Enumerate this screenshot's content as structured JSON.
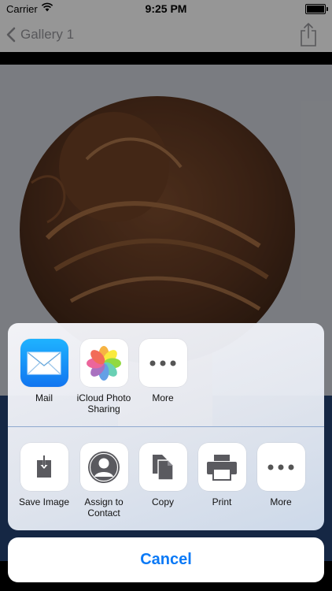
{
  "status_bar": {
    "carrier": "Carrier",
    "time": "9:25 PM"
  },
  "nav": {
    "back_label": "Gallery 1"
  },
  "share_sheet": {
    "apps": [
      {
        "label": "Mail",
        "icon": "mail-icon"
      },
      {
        "label": "iCloud Photo Sharing",
        "icon": "photos-icon"
      },
      {
        "label": "More",
        "icon": "more-icon"
      }
    ],
    "actions": [
      {
        "label": "Save Image",
        "icon": "save-image-icon"
      },
      {
        "label": "Assign to Contact",
        "icon": "contact-icon"
      },
      {
        "label": "Copy",
        "icon": "copy-icon"
      },
      {
        "label": "Print",
        "icon": "print-icon"
      },
      {
        "label": "More",
        "icon": "more-icon"
      }
    ],
    "cancel_label": "Cancel"
  },
  "colors": {
    "accent": "#0a79f6",
    "mail_blue": "#1a9af7",
    "nav_gray": "#8e8e93"
  }
}
